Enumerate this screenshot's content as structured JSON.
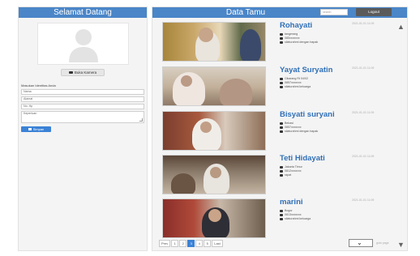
{
  "left_panel": {
    "title": "Selamat Datang",
    "camera_button": "Buka Kamera",
    "form_label": "Masukan Identitas Anda",
    "fields": [
      {
        "placeholder": "Nama"
      },
      {
        "placeholder": "Alamat"
      },
      {
        "placeholder": "No. Hp"
      },
      {
        "placeholder": "Keperluan"
      }
    ],
    "save_button": "Simpan"
  },
  "right_panel": {
    "title": "Data Tamu",
    "search_placeholder": "search",
    "logout_button": "Logout",
    "guests": [
      {
        "name": "Rohayati",
        "datetime": "2021-01-01 11:09",
        "address": "tangerang",
        "phone": "085xxxxxxx",
        "purpose": "silaturahmi dengan bapak"
      },
      {
        "name": "Yayat Suryatin",
        "datetime": "2021-01-01 11:09",
        "address": "Cikarang Rt 04/02",
        "phone": "0857xxxxxxx",
        "purpose": "silaturahmi keluarga"
      },
      {
        "name": "Bisyati suryani",
        "datetime": "2021-01-01 11:09",
        "address": "Bekasi",
        "phone": "0857xxxxxxx",
        "purpose": "silaturahmi dengan bapak"
      },
      {
        "name": "Teti Hidayati",
        "datetime": "2021-01-01 11:09",
        "address": "Jakarta Timur",
        "phone": "0812xxxxxxx",
        "purpose": "rapat"
      },
      {
        "name": "marini",
        "datetime": "2021-01-01 11:09",
        "address": "Bogor",
        "phone": "0813xxxxxxx",
        "purpose": "silaturahmi keluarga"
      }
    ],
    "pagination": [
      "Prev",
      "1",
      "2",
      "3",
      "4",
      "5",
      "Last"
    ],
    "active_page": "3",
    "jump_label": "goto page"
  },
  "colors": {
    "header": "#4a86c8",
    "accent": "#3b82d6",
    "name": "#2f6fb7"
  },
  "icons": [
    "user-silhouette-icon",
    "camera-icon",
    "save-icon",
    "map-marker-icon",
    "phone-icon",
    "briefcase-icon",
    "chevron-down-icon",
    "scroll-up-icon",
    "scroll-down-icon"
  ]
}
